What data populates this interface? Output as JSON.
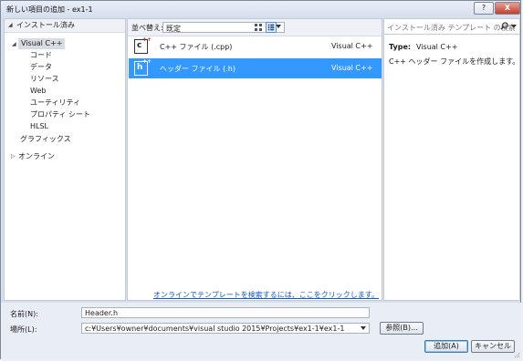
{
  "window": {
    "title": "新しい項目の追加 - ex1-1",
    "help_label": "?",
    "close_label": "X"
  },
  "left_tree": {
    "header": "インストール済み",
    "root": "Visual C++",
    "children": [
      "コード",
      "データ",
      "リソース",
      "Web",
      "ユーティリティ",
      "プロパティ シート",
      "HLSL"
    ],
    "graphics": "グラフィックス",
    "online": "オンライン"
  },
  "toolbar": {
    "sort_label": "並べ替え:",
    "sort_value": "既定"
  },
  "templates": [
    {
      "icon": "cpp-file-icon",
      "glyph": "c",
      "name": "C++ ファイル (.cpp)",
      "lang": "Visual C++",
      "selected": false
    },
    {
      "icon": "header-file-icon",
      "glyph": "h",
      "name": "ヘッダー ファイル (.h)",
      "lang": "Visual C++",
      "selected": true
    }
  ],
  "online_link": "オンラインでテンプレートを検索するには、ここをクリックします。",
  "details": {
    "search_placeholder": "インストール済み テンプレート の検索",
    "type_label": "Type:",
    "type_value": "Visual C++",
    "description": "C++ ヘッダー ファイルを作成します。"
  },
  "form": {
    "name_label": "名前(N):",
    "name_value": "Header.h",
    "location_label": "場所(L):",
    "location_value": "c:¥Users¥owner¥documents¥visual studio 2015¥Projects¥ex1-1¥ex1-1",
    "browse_label": "参照(B)...",
    "add_label": "追加(A)",
    "cancel_label": "キャンセル"
  },
  "colors": {
    "selection": "#3399ff",
    "link": "#1b55c4",
    "close_button": "#c4412c"
  }
}
